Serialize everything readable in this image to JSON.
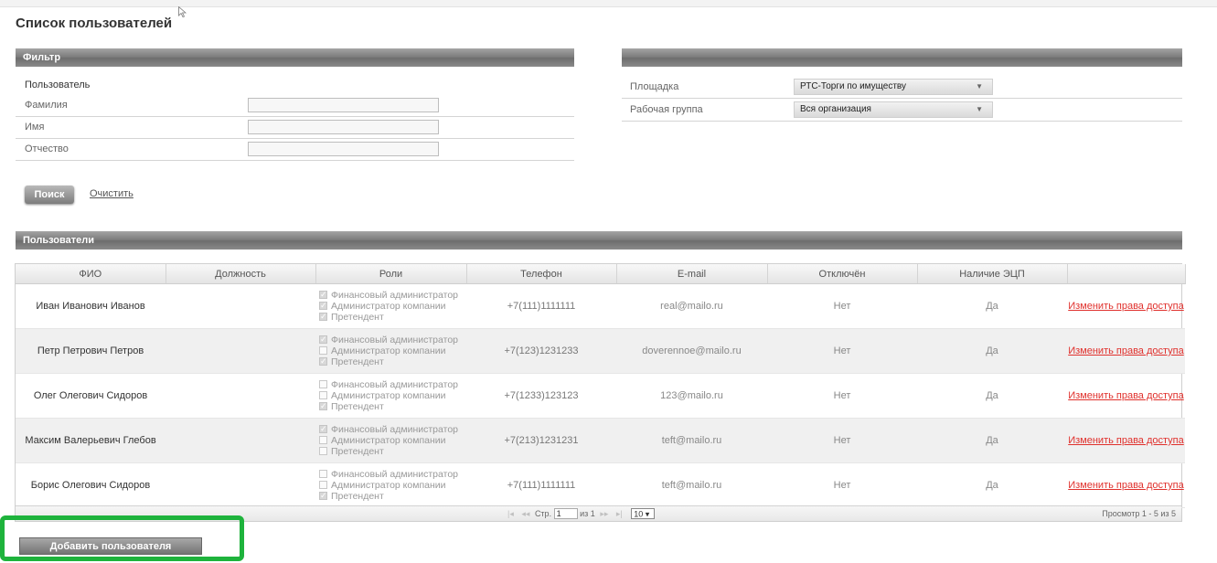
{
  "page": {
    "title": "Список пользователей"
  },
  "filter": {
    "header": "Фильтр",
    "section": "Пользователь",
    "fields": [
      {
        "label": "Фамилия",
        "value": ""
      },
      {
        "label": "Имя",
        "value": ""
      },
      {
        "label": "Отчество",
        "value": ""
      }
    ],
    "search_label": "Поиск",
    "clear_label": "Очистить"
  },
  "right": {
    "platform_label": "Площадка",
    "platform_value": "РТС-Торги по имуществу",
    "group_label": "Рабочая группа",
    "group_value": "Вся организация"
  },
  "users": {
    "header": "Пользователи",
    "columns": [
      "ФИО",
      "Должность",
      "Роли",
      "Телефон",
      "E-mail",
      "Отключён",
      "Наличие ЭЦП",
      ""
    ],
    "role_names": [
      "Финансовый администратор",
      "Администратор компании",
      "Претендент"
    ],
    "rows": [
      {
        "name": "Иван Иванович Иванов",
        "position": "",
        "roles": [
          true,
          true,
          true
        ],
        "phone": "+7(111)1111111",
        "email": "real@mailo.ru",
        "disabled": "Нет",
        "eds": "Да",
        "action": "Изменить права доступа"
      },
      {
        "name": "Петр Петрович Петров",
        "position": "",
        "roles": [
          true,
          false,
          true
        ],
        "phone": "+7(123)1231233",
        "email": "doverennoe@mailo.ru",
        "disabled": "Нет",
        "eds": "Да",
        "action": "Изменить права доступа"
      },
      {
        "name": "Олег Олегович Сидоров",
        "position": "",
        "roles": [
          false,
          false,
          true
        ],
        "phone": "+7(1233)123123",
        "email": "123@mailo.ru",
        "disabled": "Нет",
        "eds": "Да",
        "action": "Изменить права доступа"
      },
      {
        "name": "Максим Валерьевич Глебов",
        "position": "",
        "roles": [
          true,
          false,
          false
        ],
        "phone": "+7(213)1231231",
        "email": "teft@mailo.ru",
        "disabled": "Нет",
        "eds": "Да",
        "action": "Изменить права доступа"
      },
      {
        "name": "Борис Олегович Сидоров",
        "position": "",
        "roles": [
          false,
          false,
          true
        ],
        "phone": "+7(111)1111111",
        "email": "teft@mailo.ru",
        "disabled": "Нет",
        "eds": "Да",
        "action": "Изменить права доступа"
      }
    ]
  },
  "pager": {
    "page_label": "Стр.",
    "page": "1",
    "of_label": "из",
    "total_pages": "1",
    "page_size": "10",
    "info": "Просмотр 1 - 5 из 5"
  },
  "add_user_label": "Добавить пользователя",
  "colors": {
    "highlight": "#1eb33c",
    "link": "#e0302c",
    "header_bar": "#7b7b7b"
  }
}
